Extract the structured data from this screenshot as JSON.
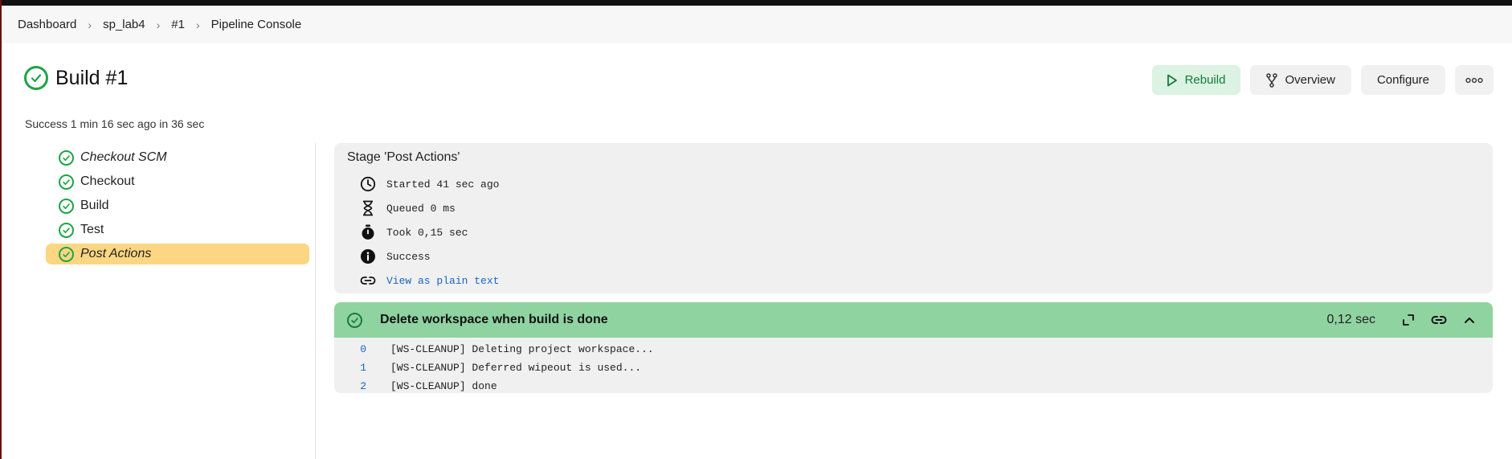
{
  "breadcrumb": [
    "Dashboard",
    "sp_lab4",
    "#1",
    "Pipeline Console"
  ],
  "header": {
    "title": "Build #1",
    "summary": "Success 1 min 16 sec ago in 36 sec"
  },
  "actions": {
    "rebuild": "Rebuild",
    "overview": "Overview",
    "configure": "Configure"
  },
  "stages": [
    {
      "label": "Checkout SCM",
      "italic": true
    },
    {
      "label": "Checkout",
      "italic": false
    },
    {
      "label": "Build",
      "italic": false
    },
    {
      "label": "Test",
      "italic": false
    },
    {
      "label": "Post Actions",
      "italic": true,
      "active": true
    }
  ],
  "stage_panel": {
    "heading": "Stage 'Post Actions'",
    "started": "Started 41 sec ago",
    "queued": "Queued 0 ms",
    "took": "Took 0,15 sec",
    "status": "Success",
    "plain_text_link": "View as plain text"
  },
  "step": {
    "title": "Delete workspace when build is done",
    "duration": "0,12 sec",
    "log": [
      {
        "num": "0",
        "text": "[WS-CLEANUP] Deleting project workspace..."
      },
      {
        "num": "1",
        "text": "[WS-CLEANUP] Deferred wipeout is used..."
      },
      {
        "num": "2",
        "text": "[WS-CLEANUP] done"
      }
    ]
  },
  "colors": {
    "success": "#1ea446",
    "active_stage": "#fdd683",
    "step_header": "#8fd3a1",
    "link": "#1565c0"
  }
}
